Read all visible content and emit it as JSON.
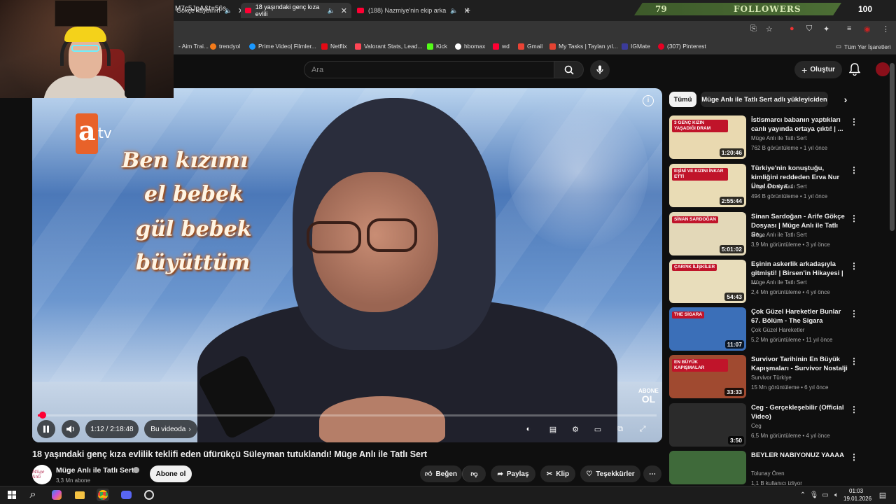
{
  "browser": {
    "tabs": [
      {
        "label": "Gökçe kaybının",
        "active": false
      },
      {
        "label": "18 yaşındaki genç kıza evlili",
        "active": true
      },
      {
        "label": "(188) Nazmiye'nin ekip arka",
        "active": false
      }
    ],
    "url": "M7c5JpA&t=56s",
    "followers_count": "79",
    "followers_label": "FOLLOWERS",
    "followers_goal": "100",
    "bookmarks": [
      {
        "label": "- Aim Trai...",
        "color": "#2a2a2a"
      },
      {
        "label": "trendyol",
        "color": "#f27a1a"
      },
      {
        "label": "Prime Video| Filmler...",
        "color": "#1a98ff"
      },
      {
        "label": "Netflix",
        "color": "#e50914"
      },
      {
        "label": "Valorant Stats, Lead...",
        "color": "#ff4655"
      },
      {
        "label": "Kick",
        "color": "#53fc18"
      },
      {
        "label": "hbomax",
        "color": "#ffffff"
      },
      {
        "label": "wd",
        "color": "#ff0033"
      },
      {
        "label": "Gmail",
        "color": "#ea4335"
      },
      {
        "label": "My Tasks | Taylan yıl...",
        "color": "#e44332"
      },
      {
        "label": "IGMate",
        "color": "#3b3b9a"
      },
      {
        "label": "(307) Pinterest",
        "color": "#e60023"
      },
      {
        "label": "Tüm Yer İşaretleri",
        "color": "#353535"
      }
    ]
  },
  "youtube": {
    "search_placeholder": "Ara",
    "create_label": "Oluştur",
    "chips": [
      "Tümü",
      "Müge Anlı ile Tatlı Sert adlı yükleyiciden"
    ],
    "video": {
      "caption_lines": [
        "Ben kızımı",
        "el bebek",
        "gül bebek",
        "büyüttüm"
      ],
      "logo_letter": "a",
      "logo_suffix": "tv",
      "abone_top": "ABONE",
      "abone_bottom": "OL",
      "time": "1:12 / 2:18:48",
      "chapter": "Bu videoda",
      "progress": 0.009,
      "title": "18 yaşındaki genç kıza evlilik teklifi eden üfürükçü Süleyman tutuklandı! Müge Anlı ile Tatlı Sert"
    },
    "channel": {
      "name": "Müge Anlı ile Tatlı Sert",
      "subs": "3,3 Mn abone",
      "subscribe": "Abone ol",
      "avatar_text": "Müge Anlı"
    },
    "actions": {
      "like": "Beğen",
      "share": "Paylaş",
      "clip": "Klip",
      "thanks": "Teşekkürler"
    },
    "recommendations": [
      {
        "title": "İstismarcı babanın yaptıkları canlı yayında ortaya çıktı! | ...",
        "channel": "Müge Anlı ile Tatlı Sert",
        "views": "762 B görüntüleme • 1 yıl önce",
        "duration": "1:20:46",
        "thumb_text": "3 GENÇ KIZIN YAŞADIĞI DRAM",
        "thumb_color": "#e9d9b0"
      },
      {
        "title": "Türkiye'nin konuştuğu, kimliğini reddeden Erva Nur Ünal Dosya...",
        "channel": "Müge Anlı ile Tatlı Sert",
        "views": "494 B görüntüleme • 1 yıl önce",
        "duration": "2:55:44",
        "thumb_text": "EŞİNİ VE KIZINI İNKAR ETTİ",
        "thumb_color": "#e9dcb5"
      },
      {
        "title": "Sinan Sardoğan - Arife Gökçe Dosyası | Müge Anlı ile Tatlı Se...",
        "channel": "Müge Anlı ile Tatlı Sert",
        "views": "3,9 Mn görüntüleme • 3 yıl önce",
        "duration": "5:01:02",
        "thumb_text": "SİNAN SARDOĞAN",
        "thumb_color": "#e3d8b8"
      },
      {
        "title": "Eşinin askerlik arkadaşıyla gitmişti! | Birsen'in Hikayesi | ...",
        "channel": "Müge Anlı ile Tatlı Sert",
        "views": "2,4 Mn görüntüleme • 4 yıl önce",
        "duration": "54:43",
        "thumb_text": "ÇARPIK İLİŞKİLER",
        "thumb_color": "#e8ddbb"
      },
      {
        "title": "Çok Güzel Hareketler Bunlar 67. Bölüm - The Sigara",
        "channel": "Çok Güzel Hareketler",
        "views": "5,2 Mn görüntüleme • 11 yıl önce",
        "duration": "11:07",
        "thumb_text": "THE SİGARA",
        "thumb_color": "#3b6fb8"
      },
      {
        "title": "Survivor Tarihinin En Büyük Kapışmaları - Survivor Nostalji",
        "channel": "Survivor Türkiye",
        "views": "15 Mn görüntüleme • 6 yıl önce",
        "duration": "33:33",
        "thumb_text": "EN BÜYÜK KAPIŞMALAR",
        "thumb_color": "#a04a30"
      },
      {
        "title": "Ceg - Gerçekleşebilir (Official Video)",
        "channel": "Ceg",
        "views": "6,5 Mn görüntüleme • 4 yıl önce",
        "duration": "3:50",
        "thumb_text": "",
        "thumb_color": "#2b2b2b"
      },
      {
        "title": "BEYLER NABIYONUZ YAAAA",
        "channel": "Tolunay Ören",
        "views": "1,1 B kullanıcı izliyor",
        "duration": "",
        "thumb_text": "",
        "thumb_color": "#3f6a3a"
      }
    ]
  },
  "taskbar": {
    "time": "01:03",
    "date": "19.01.2026"
  }
}
